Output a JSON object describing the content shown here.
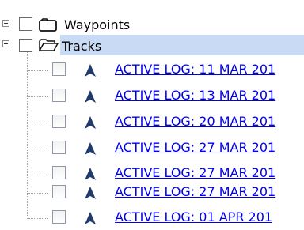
{
  "tree": {
    "waypoints": {
      "label": "Waypoints",
      "icon": "folder-closed-icon"
    },
    "tracks": {
      "label": "Tracks",
      "icon": "folder-open-icon",
      "selected_bg": "#c9daf4",
      "items": [
        {
          "label": "ACTIVE LOG: 11 MAR 201"
        },
        {
          "label": "ACTIVE LOG: 13 MAR 201"
        },
        {
          "label": "ACTIVE LOG: 20 MAR 201"
        },
        {
          "label": "ACTIVE LOG: 27 MAR 201"
        },
        {
          "label": "ACTIVE LOG: 27 MAR 201"
        },
        {
          "label": "ACTIVE LOG: 27 MAR 201"
        },
        {
          "label": "ACTIVE LOG: 01 APR 201"
        }
      ]
    }
  },
  "colors": {
    "link": "#0000ee",
    "track_icon": "#1f3a6b"
  }
}
